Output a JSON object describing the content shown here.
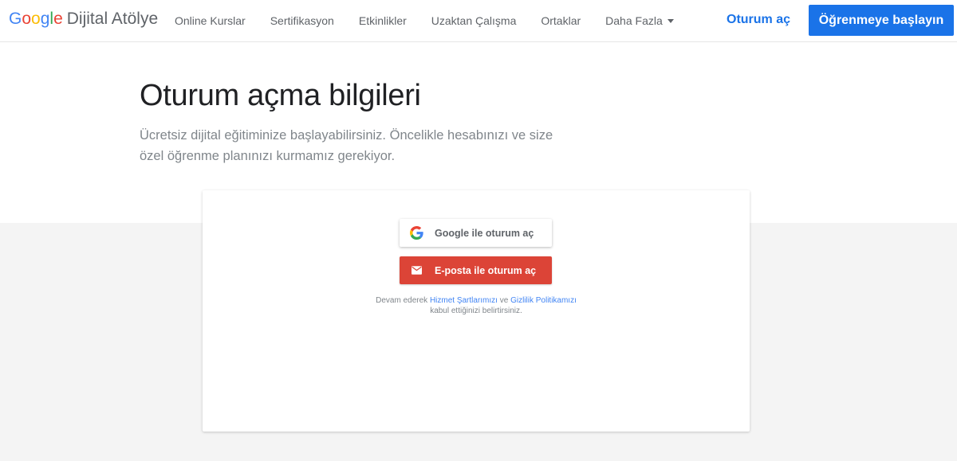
{
  "brand": {
    "google_letters": [
      "G",
      "o",
      "o",
      "g",
      "l",
      "e"
    ],
    "google_colors": [
      "#4285F4",
      "#EA4335",
      "#FBBC05",
      "#4285F4",
      "#34A853",
      "#EA4335"
    ],
    "product": "Dijital Atölye"
  },
  "nav": {
    "items": [
      "Online Kurslar",
      "Sertifikasyon",
      "Etkinlikler",
      "Uzaktan Çalışma",
      "Ortaklar"
    ],
    "more_label": "Daha Fazla",
    "signin_label": "Oturum aç",
    "cta_label": "Öğrenmeye başlayın"
  },
  "hero": {
    "title": "Oturum açma bilgileri",
    "subtitle": "Ücretsiz dijital eğitiminize başlayabilirsiniz. Öncelikle hesabınızı ve size özel öğrenme planınızı kurmamız gerekiyor."
  },
  "card": {
    "google_button": {
      "label": "Google ile oturum aç",
      "icon": "google-g-icon"
    },
    "email_button": {
      "label": "E-posta ile oturum aç",
      "icon": "mail-icon"
    },
    "terms": {
      "prefix": "Devam ederek ",
      "link1": "Hizmet Şartlarımızı",
      "middle": " ve ",
      "link2": "Gizlilik Politikamızı",
      "suffix": "kabul ettiğinizi belirtirsiniz."
    }
  },
  "colors": {
    "accent": "#1a73e8",
    "email_button": "#dc4437",
    "link": "#4285f4"
  }
}
